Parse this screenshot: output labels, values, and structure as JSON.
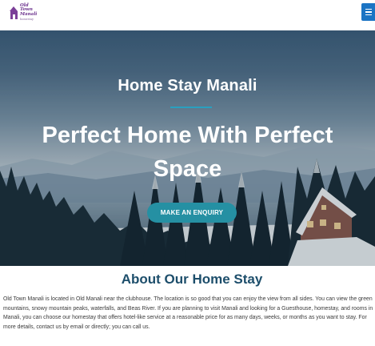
{
  "header": {
    "logo": {
      "line1": "Old",
      "line2": "Town",
      "line3": "Manali",
      "tagline": "homestay"
    },
    "menu_button": {
      "icon": "hamburger-menu-icon",
      "color": "#1b74c4"
    }
  },
  "hero": {
    "subtitle": "Home Stay Manali",
    "title": "Perfect Home With Perfect Space",
    "cta_label": "MAKE AN ENQUIRY",
    "accent_color": "#2590a3"
  },
  "about": {
    "heading": "About Our Home Stay",
    "body": "Old Town Manali is located in Old Manali near the clubhouse. The location is so good that you can enjoy the view from all sides. You can view the green mountains, snowy mountain peaks, waterfalls, and Beas River. If you are planning to visit Manali and looking for a Guesthouse, homestay, and rooms in Manali, you can choose our homestay that offers hotel-like service at a reasonable price for as many days, weeks, or months as you want to stay. For more details, contact us by email or directly; you can call us.",
    "heading_color": "#1d4e6b"
  }
}
